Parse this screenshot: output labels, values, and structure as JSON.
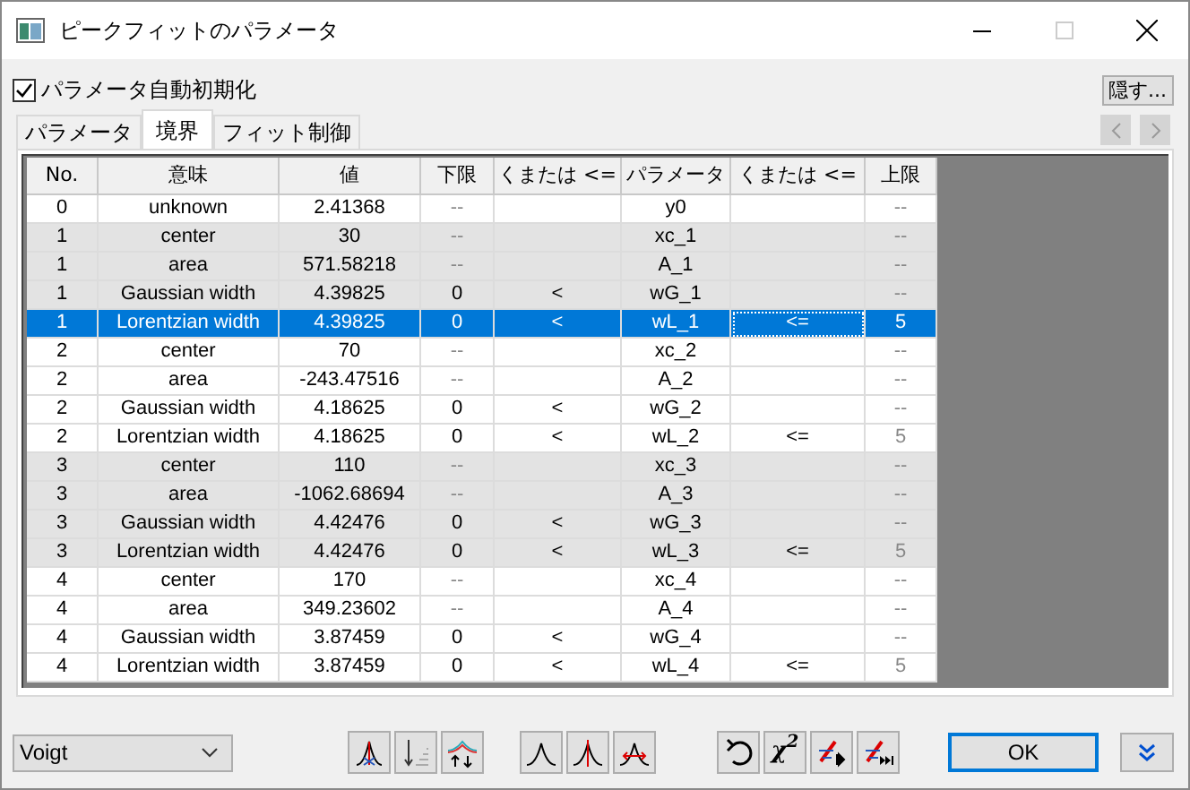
{
  "window": {
    "title": "ピークフィットのパラメータ"
  },
  "auto_init": {
    "label": "パラメータ自動初期化",
    "checked": true
  },
  "hide_button": "隠す...",
  "tabs": [
    {
      "label": "パラメータ",
      "selected": false
    },
    {
      "label": "境界",
      "selected": true
    },
    {
      "label": "フィット制御",
      "selected": false
    }
  ],
  "table": {
    "columns": [
      "No.",
      "意味",
      "値",
      "下限",
      "くまたは <=",
      "パラメータ",
      "くまたは <=",
      "上限"
    ],
    "rows": [
      {
        "cells": [
          "0",
          "unknown",
          "2.41368",
          "--",
          "",
          "y0",
          "",
          "--"
        ],
        "shaded": false,
        "selected": false,
        "lower_disabled": true,
        "upper_disabled": true
      },
      {
        "cells": [
          "1",
          "center",
          "30",
          "--",
          "",
          "xc_1",
          "",
          "--"
        ],
        "shaded": true,
        "selected": false,
        "lower_disabled": true,
        "upper_disabled": true
      },
      {
        "cells": [
          "1",
          "area",
          "571.58218",
          "--",
          "",
          "A_1",
          "",
          "--"
        ],
        "shaded": true,
        "selected": false,
        "lower_disabled": true,
        "upper_disabled": true
      },
      {
        "cells": [
          "1",
          "Gaussian width",
          "4.39825",
          "0",
          "<",
          "wG_1",
          "",
          "--"
        ],
        "shaded": true,
        "selected": false,
        "lower_disabled": false,
        "upper_disabled": true
      },
      {
        "cells": [
          "1",
          "Lorentzian width",
          "4.39825",
          "0",
          "<",
          "wL_1",
          "<=",
          "5"
        ],
        "selected": true,
        "lower_disabled": false,
        "upper_disabled": false
      },
      {
        "cells": [
          "2",
          "center",
          "70",
          "--",
          "",
          "xc_2",
          "",
          "--"
        ],
        "shaded": false,
        "selected": false,
        "lower_disabled": true,
        "upper_disabled": true
      },
      {
        "cells": [
          "2",
          "area",
          "-243.47516",
          "--",
          "",
          "A_2",
          "",
          "--"
        ],
        "shaded": false,
        "selected": false,
        "lower_disabled": true,
        "upper_disabled": true
      },
      {
        "cells": [
          "2",
          "Gaussian width",
          "4.18625",
          "0",
          "<",
          "wG_2",
          "",
          "--"
        ],
        "shaded": false,
        "selected": false,
        "lower_disabled": false,
        "upper_disabled": true
      },
      {
        "cells": [
          "2",
          "Lorentzian width",
          "4.18625",
          "0",
          "<",
          "wL_2",
          "<=",
          "5"
        ],
        "shaded": false,
        "selected": false,
        "lower_disabled": false,
        "upper_disabled": true
      },
      {
        "cells": [
          "3",
          "center",
          "110",
          "--",
          "",
          "xc_3",
          "",
          "--"
        ],
        "shaded": true,
        "selected": false,
        "lower_disabled": true,
        "upper_disabled": true
      },
      {
        "cells": [
          "3",
          "area",
          "-1062.68694",
          "--",
          "",
          "A_3",
          "",
          "--"
        ],
        "shaded": true,
        "selected": false,
        "lower_disabled": true,
        "upper_disabled": true
      },
      {
        "cells": [
          "3",
          "Gaussian width",
          "4.42476",
          "0",
          "<",
          "wG_3",
          "",
          "--"
        ],
        "shaded": true,
        "selected": false,
        "lower_disabled": false,
        "upper_disabled": true
      },
      {
        "cells": [
          "3",
          "Lorentzian width",
          "4.42476",
          "0",
          "<",
          "wL_3",
          "<=",
          "5"
        ],
        "shaded": true,
        "selected": false,
        "lower_disabled": false,
        "upper_disabled": true
      },
      {
        "cells": [
          "4",
          "center",
          "170",
          "--",
          "",
          "xc_4",
          "",
          "--"
        ],
        "shaded": false,
        "selected": false,
        "lower_disabled": true,
        "upper_disabled": true
      },
      {
        "cells": [
          "4",
          "area",
          "349.23602",
          "--",
          "",
          "A_4",
          "",
          "--"
        ],
        "shaded": false,
        "selected": false,
        "lower_disabled": true,
        "upper_disabled": true
      },
      {
        "cells": [
          "4",
          "Gaussian width",
          "3.87459",
          "0",
          "<",
          "wG_4",
          "",
          "--"
        ],
        "shaded": false,
        "selected": false,
        "lower_disabled": false,
        "upper_disabled": true
      },
      {
        "cells": [
          "4",
          "Lorentzian width",
          "3.87459",
          "0",
          "<",
          "wL_4",
          "<=",
          "5"
        ],
        "shaded": false,
        "selected": false,
        "lower_disabled": false,
        "upper_disabled": true
      }
    ]
  },
  "function_select": {
    "value": "Voigt"
  },
  "chi_square_button": "χ$^{2}$",
  "ok_button": "OK"
}
